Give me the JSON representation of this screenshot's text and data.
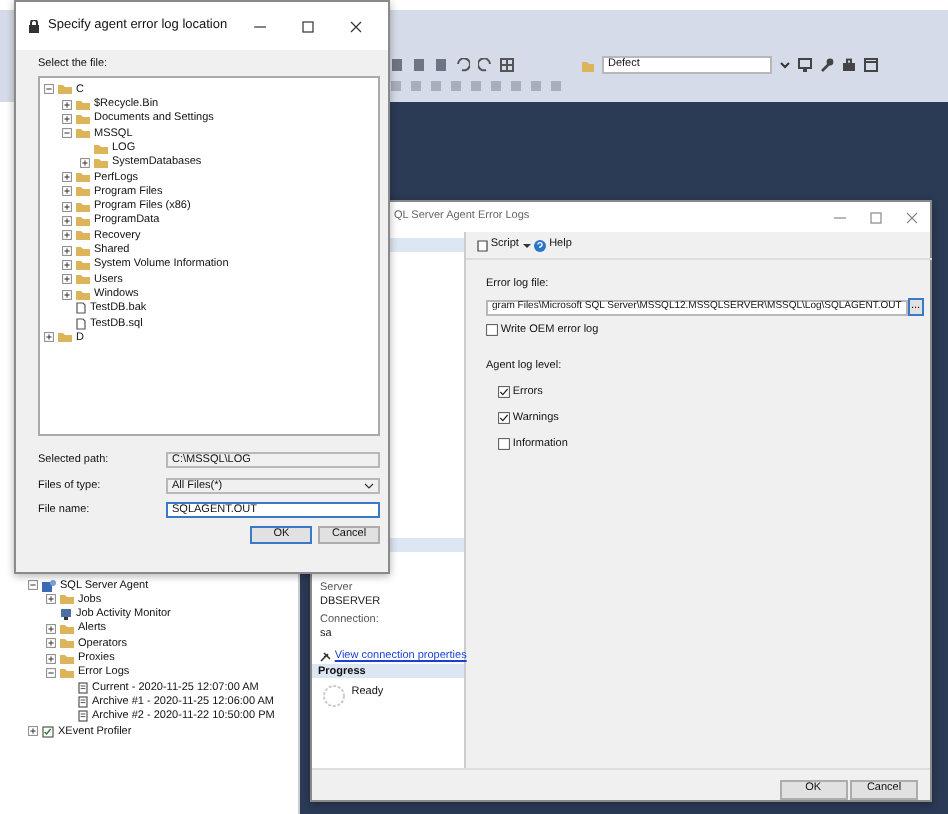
{
  "toolbar": {
    "configuration_combo": "Defect"
  },
  "object_explorer": {
    "items": [
      {
        "label": "SQL Server Agent",
        "kind": "agent",
        "expanded": true,
        "children": [
          {
            "label": "Jobs",
            "kind": "folder",
            "expanded": false
          },
          {
            "label": "Job Activity Monitor",
            "kind": "monitor"
          },
          {
            "label": "Alerts",
            "kind": "folder",
            "expanded": false
          },
          {
            "label": "Operators",
            "kind": "folder",
            "expanded": false
          },
          {
            "label": "Proxies",
            "kind": "folder",
            "expanded": false
          },
          {
            "label": "Error Logs",
            "kind": "folder",
            "expanded": true,
            "children": [
              {
                "label": "Current - 2020-11-25 12:07:00 AM",
                "kind": "log"
              },
              {
                "label": "Archive #1 - 2020-11-25 12:06:00 AM",
                "kind": "log"
              },
              {
                "label": "Archive #2 - 2020-11-22 10:50:00 PM",
                "kind": "log"
              }
            ]
          }
        ]
      },
      {
        "label": "XEvent Profiler",
        "kind": "profiler",
        "expanded": false
      }
    ]
  },
  "error_logs_dialog": {
    "title": "QL Server Agent Error Logs",
    "toolbar": [
      {
        "label": "Script",
        "kind": "script"
      },
      {
        "label": "Help",
        "kind": "help"
      }
    ],
    "connection": {
      "server_label": "Server",
      "server": "DBSERVER",
      "connection_label": "Connection:",
      "connection": "sa",
      "link": "View connection properties"
    },
    "progress": {
      "header": "Progress",
      "status": "Ready"
    },
    "error_log_file": {
      "label": "Error log file:",
      "value": "gram Files\\Microsoft SQL Server\\MSSQL12.MSSQLSERVER\\MSSQL\\Log\\SQLAGENT.OUT",
      "browse": "..."
    },
    "write_oem": {
      "label": "Write OEM error log",
      "checked": false
    },
    "log_level": {
      "label": "Agent log level:",
      "options": [
        {
          "label": "Errors",
          "checked": true
        },
        {
          "label": "Warnings",
          "checked": true
        },
        {
          "label": "Information",
          "checked": false
        }
      ]
    },
    "buttons": [
      "OK",
      "Cancel"
    ]
  },
  "file_dialog": {
    "title": "Specify agent error log location",
    "prompt": "Select the file:",
    "tree": [
      {
        "label": "C",
        "kind": "folder",
        "expanded": true,
        "children": [
          {
            "label": "$Recycle.Bin",
            "kind": "folder",
            "expanded": false
          },
          {
            "label": "Documents and Settings",
            "kind": "folder",
            "expanded": false
          },
          {
            "label": "MSSQL",
            "kind": "folder",
            "expanded": true,
            "children": [
              {
                "label": "LOG",
                "kind": "folder"
              },
              {
                "label": "SystemDatabases",
                "kind": "folder",
                "expanded": false
              }
            ]
          },
          {
            "label": "PerfLogs",
            "kind": "folder",
            "expanded": false
          },
          {
            "label": "Program Files",
            "kind": "folder",
            "expanded": false
          },
          {
            "label": "Program Files (x86)",
            "kind": "folder",
            "expanded": false
          },
          {
            "label": "ProgramData",
            "kind": "folder",
            "expanded": false
          },
          {
            "label": "Recovery",
            "kind": "folder",
            "expanded": false
          },
          {
            "label": "Shared",
            "kind": "folder",
            "expanded": false
          },
          {
            "label": "System Volume Information",
            "kind": "folder",
            "expanded": false
          },
          {
            "label": "Users",
            "kind": "folder",
            "expanded": false
          },
          {
            "label": "Windows",
            "kind": "folder",
            "expanded": false
          },
          {
            "label": "TestDB.bak",
            "kind": "file"
          },
          {
            "label": "TestDB.sql",
            "kind": "file"
          }
        ]
      },
      {
        "label": "D",
        "kind": "folder",
        "expanded": false
      }
    ],
    "selected_path": {
      "label": "Selected path:",
      "value": "C:\\MSSQL\\LOG"
    },
    "files_of_type": {
      "label": "Files of type:",
      "value": "All Files(*)"
    },
    "file_name": {
      "label": "File name:",
      "value": "SQLAGENT.OUT"
    },
    "buttons": [
      "OK",
      "Cancel"
    ]
  }
}
